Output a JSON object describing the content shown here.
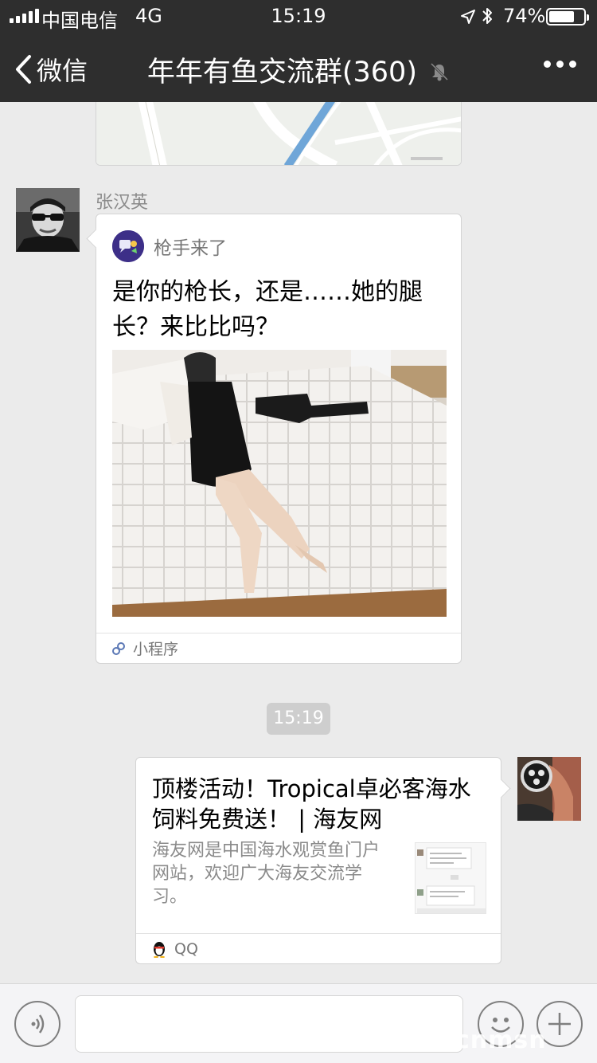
{
  "status_bar": {
    "carrier": "中国电信",
    "network": "4G",
    "time": "15:19",
    "battery_percent_label": "74%",
    "battery_level": 0.74,
    "icons": [
      "signal-icon",
      "location-arrow-icon",
      "bluetooth-icon",
      "battery-icon"
    ]
  },
  "nav": {
    "back_label": "微信",
    "title": "年年有鱼交流群(360)",
    "icons": [
      "chevron-left-icon",
      "mute-bell-icon",
      "more-dots-icon"
    ]
  },
  "messages": {
    "mini_program": {
      "sender": "张汉英",
      "app_name": "枪手来了",
      "title": "是你的枪长，还是……她的腿长？来比比吗？",
      "footer_label": "小程序",
      "icons": [
        "avatar-icon",
        "mini-program-logo-icon",
        "mini-program-link-icon"
      ]
    },
    "timestamp": "15:19",
    "link_share": {
      "title": "顶楼活动！Tropical卓必客海水饲料免费送！ | 海友网",
      "description": "海友网是中国海水观赏鱼门户网站，欢迎广大海友交流学习。",
      "source": "QQ",
      "icons": [
        "qq-penguin-icon",
        "thumbnail-image",
        "avatar-icon"
      ]
    }
  },
  "input_bar": {
    "placeholder": "",
    "icons": [
      "voice-icon",
      "emoji-icon",
      "plus-icon"
    ]
  },
  "watermark": "cnmsn",
  "colors": {
    "nav_background": "#2e2e2e",
    "chat_background": "#ebebeb",
    "card_background": "#ffffff",
    "secondary_text": "#8a8a8a",
    "timestamp_badge": "#cecece"
  }
}
